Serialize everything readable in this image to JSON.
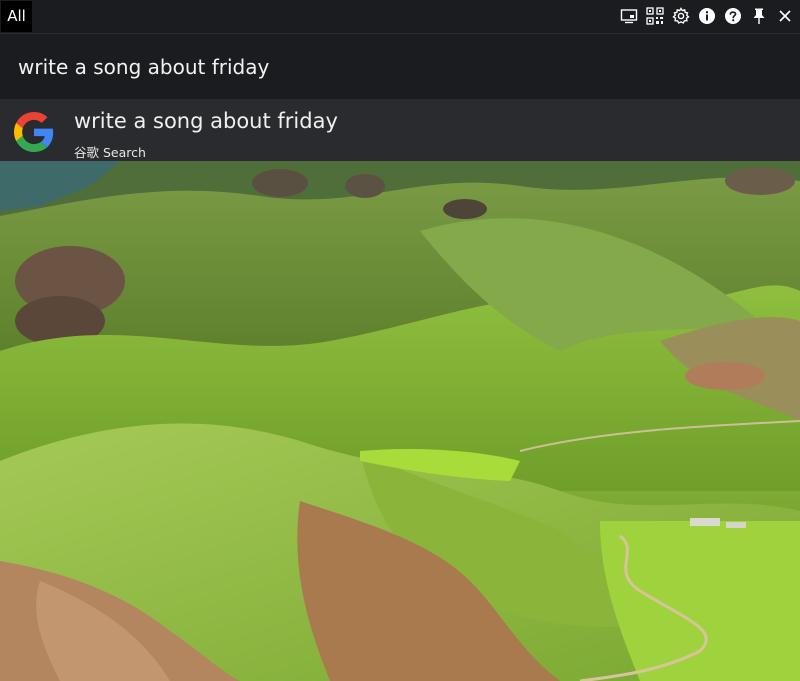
{
  "tabs": {
    "all_label": "All"
  },
  "toolbar": {
    "icons": [
      "monitor-icon",
      "qr-code-icon",
      "gear-icon",
      "info-icon",
      "help-icon",
      "pin-icon",
      "close-icon"
    ]
  },
  "search": {
    "value": "write a song about friday"
  },
  "result": {
    "title": "write a song about friday",
    "subtitle": "谷歌 Search",
    "engine_icon": "google-icon"
  },
  "colors": {
    "bar_bg": "#1b1c20",
    "result_bg": "#2a2b2e",
    "text": "#f0f0f0",
    "google_blue": "#4285F4",
    "google_red": "#EA4335",
    "google_yellow": "#FBBC05",
    "google_green": "#34A853"
  }
}
